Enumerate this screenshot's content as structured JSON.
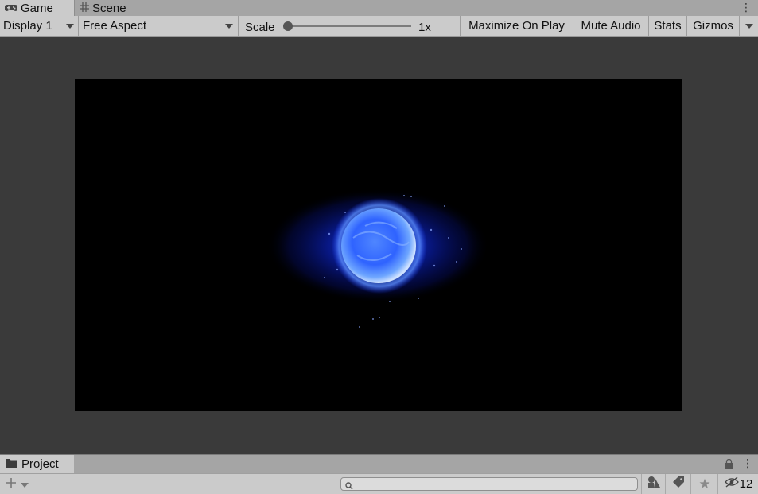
{
  "tabs": {
    "game": {
      "label": "Game",
      "icon": "gamepad-icon"
    },
    "scene": {
      "label": "Scene",
      "icon": "grid-icon"
    }
  },
  "toolbar": {
    "display": "Display 1",
    "aspect": "Free Aspect",
    "scale_label": "Scale",
    "scale_value": "1x",
    "scale_slider_level": 0,
    "maximize": "Maximize On Play",
    "mute": "Mute Audio",
    "stats": "Stats",
    "gizmos": "Gizmos"
  },
  "project": {
    "tab_label": "Project",
    "search_placeholder": "",
    "hidden_count": "12"
  },
  "colors": {
    "tab_bar": "#a5a5a5",
    "panel": "#cbcbcb",
    "background": "#3a3a3a",
    "viewport": "#000000",
    "orb_blue": "#2a5cff"
  }
}
